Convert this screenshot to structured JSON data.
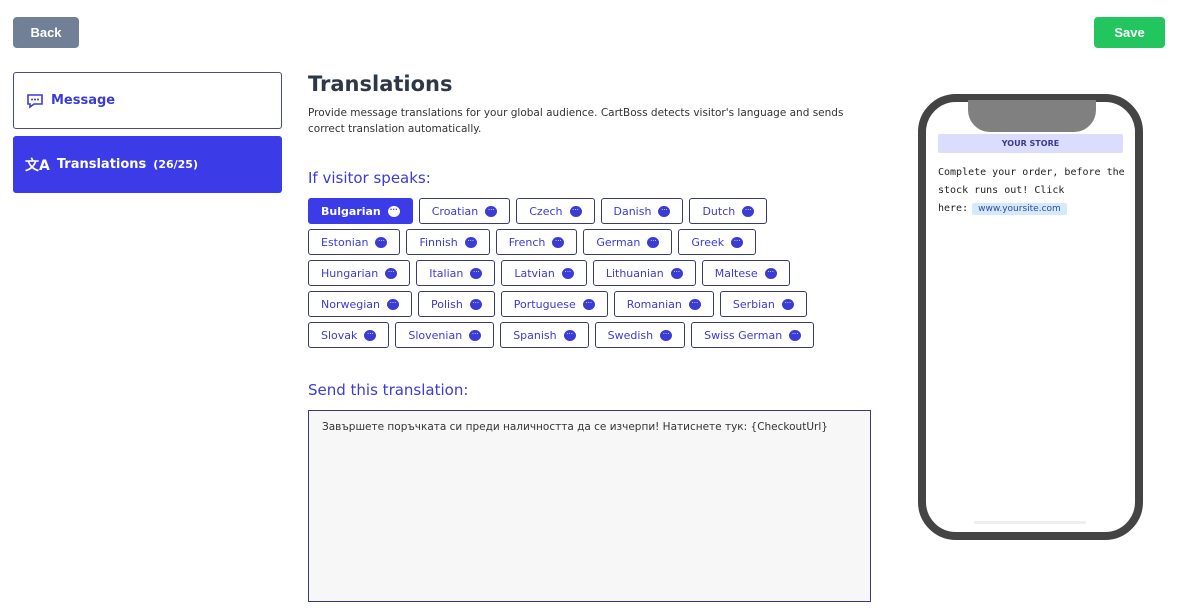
{
  "toolbar": {
    "back_label": "Back",
    "save_label": "Save"
  },
  "sidebar": {
    "items": [
      {
        "label": "Message",
        "icon": "message-icon"
      },
      {
        "label": "Translations",
        "count": "(26/25)",
        "icon": "translate-icon",
        "active": true
      }
    ]
  },
  "main": {
    "title": "Translations",
    "description": "Provide message translations for your global audience. CartBoss detects visitor's language and sends correct translation automatically.",
    "visitor_label": "If visitor speaks:",
    "languages": [
      [
        "Bulgarian",
        "Croatian",
        "Czech",
        "Danish",
        "Dutch"
      ],
      [
        "Estonian",
        "Finnish",
        "French",
        "German",
        "Greek"
      ],
      [
        "Hungarian",
        "Italian",
        "Latvian",
        "Lithuanian",
        "Maltese"
      ],
      [
        "Norwegian",
        "Polish",
        "Portuguese",
        "Romanian",
        "Serbian"
      ],
      [
        "Slovak",
        "Slovenian",
        "Spanish",
        "Swedish",
        "Swiss German"
      ]
    ],
    "selected_language": "Bulgarian",
    "send_label": "Send this translation:",
    "translation_value": "Завършете поръчката си преди наличността да се изчерпи! Натиснете тук: {CheckoutUrl}"
  },
  "preview": {
    "store": "YOUR STORE",
    "message": "Complete your order, before the stock runs out! Click here:",
    "link": "www.yoursite.com"
  },
  "colors": {
    "accent": "#3b3be8",
    "save": "#22c55e",
    "back": "#718096"
  }
}
